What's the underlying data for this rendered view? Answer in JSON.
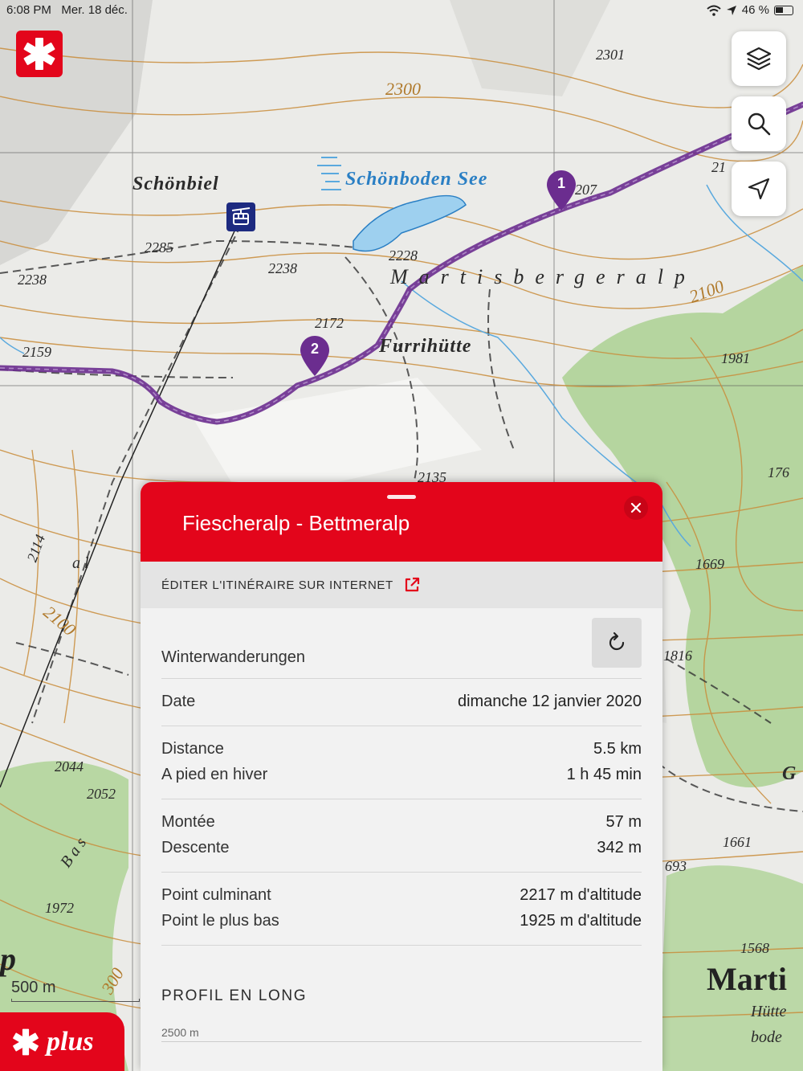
{
  "status_bar": {
    "time": "6:08 PM",
    "date": "Mer. 18 déc.",
    "battery": "46 %"
  },
  "map": {
    "labels": {
      "schonbiel": "Schönbiel",
      "lake": "Schönboden See",
      "martisbergeralp": "Martisbergeralp",
      "furrihutte": "Furrihütte",
      "town": "Marti",
      "hutte": "Hütte",
      "bode": "bode",
      "bas": "B a s",
      "al": "a   l"
    },
    "elevations": {
      "e2301": "2301",
      "e2300": "2300",
      "e2207": "207",
      "e21": "21",
      "e2285": "2285",
      "e2238a": "2238",
      "e2238b": "2238",
      "e2228": "2228",
      "e2100a": "2100",
      "e2172": "2172",
      "e2159": "2159",
      "e1981": "1981",
      "e2135": "2135",
      "e176": "176",
      "e2114": "2114",
      "e2100b": "2100",
      "e1669": "1669",
      "e1816": "1816",
      "e2044": "2044",
      "e2052": "2052",
      "e1661": "1661",
      "e693": "693",
      "e1972": "1972",
      "e1568": "1568",
      "e300": "300",
      "g": "G",
      "p": "p"
    },
    "waypoints": [
      "1",
      "2"
    ],
    "scale_label": "500 m",
    "colors": {
      "route": "#6b2d8f",
      "contour": "#c98d3b",
      "water": "#5aa9de",
      "forest": "#a7d08c"
    }
  },
  "icons": {
    "logo": "swiss-cross-icon",
    "layers": "layers-icon",
    "search": "search-icon",
    "locate": "navigation-arrow-icon",
    "cablecar": "cable-car-icon",
    "close": "close-icon",
    "external": "external-link-icon",
    "refresh": "refresh-icon"
  },
  "plus_label": "plus",
  "panel": {
    "title": "Fiescheralp - Bettmeralp",
    "edit_label": "ÉDITER L'ITINÉRAIRE SUR INTERNET",
    "category": "Winterwanderungen",
    "date_label": "Date",
    "date_value": "dimanche 12 janvier 2020",
    "distance_label": "Distance",
    "distance_value": "5.5 km",
    "walk_label": "A pied en hiver",
    "walk_value": "1 h 45 min",
    "ascent_label": "Montée",
    "ascent_value": "57 m",
    "descent_label": "Descente",
    "descent_value": "342 m",
    "highest_label": "Point culminant",
    "highest_value": "2217 m d'altitude",
    "lowest_label": "Point le plus bas",
    "lowest_value": "1925 m d'altitude",
    "profile_title": "PROFIL EN LONG",
    "profile_axis_top": "2500 m"
  },
  "accent": "#e3051b"
}
